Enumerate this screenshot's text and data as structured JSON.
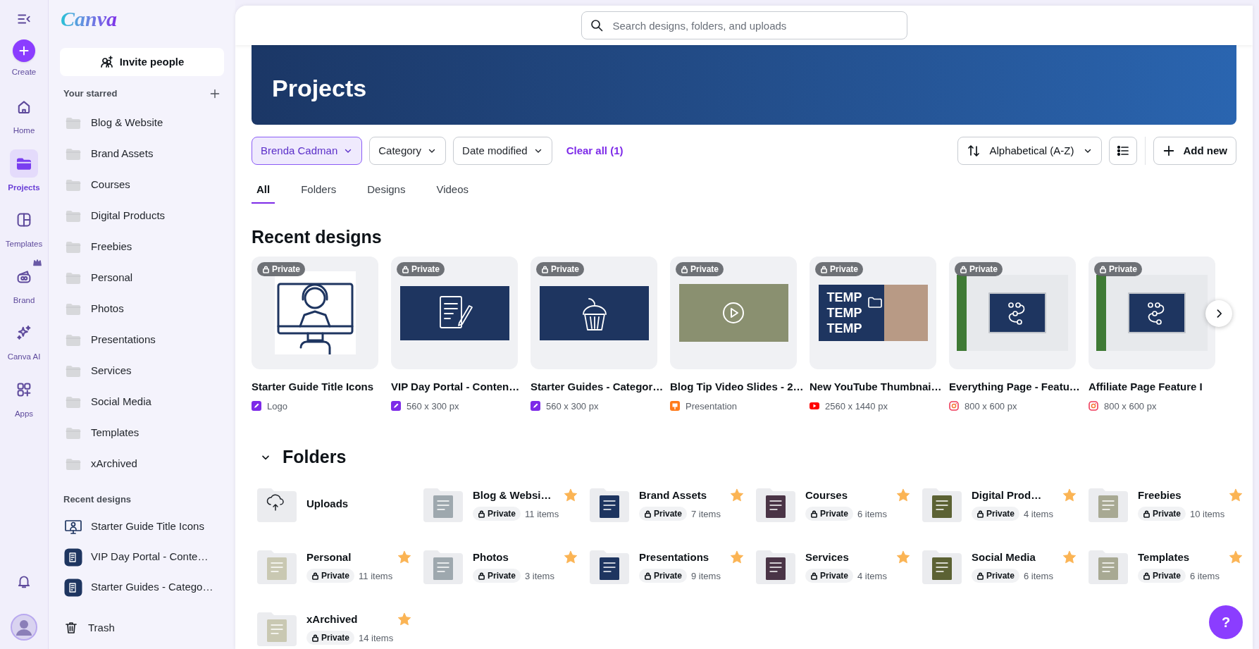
{
  "rail": {
    "items": [
      {
        "label": "Create",
        "kind": "create",
        "selected": false
      },
      {
        "label": "Home",
        "kind": "home",
        "selected": false
      },
      {
        "label": "Projects",
        "kind": "projects",
        "selected": true
      },
      {
        "label": "Templates",
        "kind": "templates",
        "selected": false
      },
      {
        "label": "Brand",
        "kind": "brand",
        "selected": false
      },
      {
        "label": "Canva AI",
        "kind": "ai",
        "selected": false
      },
      {
        "label": "Apps",
        "kind": "apps",
        "selected": false
      }
    ]
  },
  "sidebar": {
    "logo": "Canva",
    "invite_button": "Invite people",
    "starred_heading": "Your starred",
    "starred": [
      "Blog & Website",
      "Brand Assets",
      "Courses",
      "Digital Products",
      "Freebies",
      "Personal",
      "Photos",
      "Presentations",
      "Services",
      "Social Media",
      "Templates",
      "xArchived"
    ],
    "recent_heading": "Recent designs",
    "recent": [
      {
        "name": "Starter Guide Title Icons",
        "kind": "outline"
      },
      {
        "name": "VIP Day Portal - Conte…",
        "kind": "navy"
      },
      {
        "name": "Starter Guides - Catego…",
        "kind": "navy"
      }
    ],
    "trash": "Trash"
  },
  "search": {
    "placeholder": "Search designs, folders, and uploads"
  },
  "banner": {
    "title": "Projects"
  },
  "filters": [
    {
      "label": "Brenda Cadman",
      "selected": true
    },
    {
      "label": "Category",
      "selected": false
    },
    {
      "label": "Date modified",
      "selected": false
    }
  ],
  "clear_all": "Clear all (1)",
  "sort": "Alphabetical (A-Z)",
  "add_new": "Add new",
  "tabs": [
    {
      "label": "All",
      "selected": true
    },
    {
      "label": "Folders",
      "selected": false
    },
    {
      "label": "Designs",
      "selected": false
    },
    {
      "label": "Videos",
      "selected": false
    }
  ],
  "recent_designs": {
    "heading": "Recent designs",
    "items": [
      {
        "title": "Starter Guide Title Icons",
        "badge": "Private",
        "kind": "headset",
        "meta_icon": {
          "kind": "edit"
        },
        "meta": "Logo"
      },
      {
        "title": "VIP Day Portal - Conten…",
        "badge": "Private",
        "kind": "notebook",
        "meta_icon": {
          "kind": "edit"
        },
        "meta": "560 x 300 px"
      },
      {
        "title": "Starter Guides - Categor…",
        "badge": "Private",
        "kind": "cupcake",
        "meta_icon": {
          "kind": "edit"
        },
        "meta": "560 x 300 px"
      },
      {
        "title": "Blog Tip Video Slides - 2…",
        "badge": "Private",
        "kind": "video",
        "meta_icon": {
          "kind": "presentation"
        },
        "meta": "Presentation"
      },
      {
        "title": "New YouTube Thumbnai…",
        "badge": "Private",
        "kind": "youtube",
        "meta_icon": {
          "kind": "youtube"
        },
        "meta": "2560 x 1440 px",
        "thumbnail_lines": [
          "TEMP",
          "TEMP",
          "TEMP"
        ]
      },
      {
        "title": "Everything Page - Featu…",
        "badge": "Private",
        "kind": "laptop",
        "meta_icon": {
          "kind": "instagram"
        },
        "meta": "800 x 600 px"
      },
      {
        "title": "Affiliate Page Feature I",
        "badge": "Private",
        "kind": "laptop",
        "meta_icon": {
          "kind": "instagram"
        },
        "meta": "800 x 600 px"
      }
    ]
  },
  "folders": {
    "heading": "Folders",
    "expanded": true,
    "items": [
      {
        "name": "Uploads",
        "kind": "uploads",
        "starred": false
      },
      {
        "name": "Blog & Websi…",
        "kind": "folder",
        "badge": "Private",
        "count": "11 items",
        "starred": true,
        "color": "#9ea8ae"
      },
      {
        "name": "Brand Assets",
        "kind": "folder",
        "badge": "Private",
        "count": "7 items",
        "starred": true,
        "color": "#1e3560"
      },
      {
        "name": "Courses",
        "kind": "folder",
        "badge": "Private",
        "count": "6 items",
        "starred": true,
        "color": "#4a3446"
      },
      {
        "name": "Digital Prod…",
        "kind": "folder",
        "badge": "Private",
        "count": "4 items",
        "starred": true,
        "color": "#5c6234"
      },
      {
        "name": "Freebies",
        "kind": "folder",
        "badge": "Private",
        "count": "10 items",
        "starred": true,
        "color": "#a8a993"
      },
      {
        "name": "Personal",
        "kind": "folder",
        "badge": "Private",
        "count": "11 items",
        "starred": true,
        "color": "#c9c8b2"
      },
      {
        "name": "Photos",
        "kind": "folder",
        "badge": "Private",
        "count": "3 items",
        "starred": true,
        "color": "#9ea8ae"
      },
      {
        "name": "Presentations",
        "kind": "folder",
        "badge": "Private",
        "count": "9 items",
        "starred": true,
        "color": "#1e3560"
      },
      {
        "name": "Services",
        "kind": "folder",
        "badge": "Private",
        "count": "4 items",
        "starred": true,
        "color": "#4a3446"
      },
      {
        "name": "Social Media",
        "kind": "folder",
        "badge": "Private",
        "count": "6 items",
        "starred": true,
        "color": "#5c6234"
      },
      {
        "name": "Templates",
        "kind": "folder",
        "badge": "Private",
        "count": "6 items",
        "starred": true,
        "color": "#a8a993"
      },
      {
        "name": "xArchived",
        "kind": "folder",
        "badge": "Private",
        "count": "14 items",
        "starred": true,
        "color": "#c9c8b2"
      }
    ]
  },
  "help_button": "?"
}
